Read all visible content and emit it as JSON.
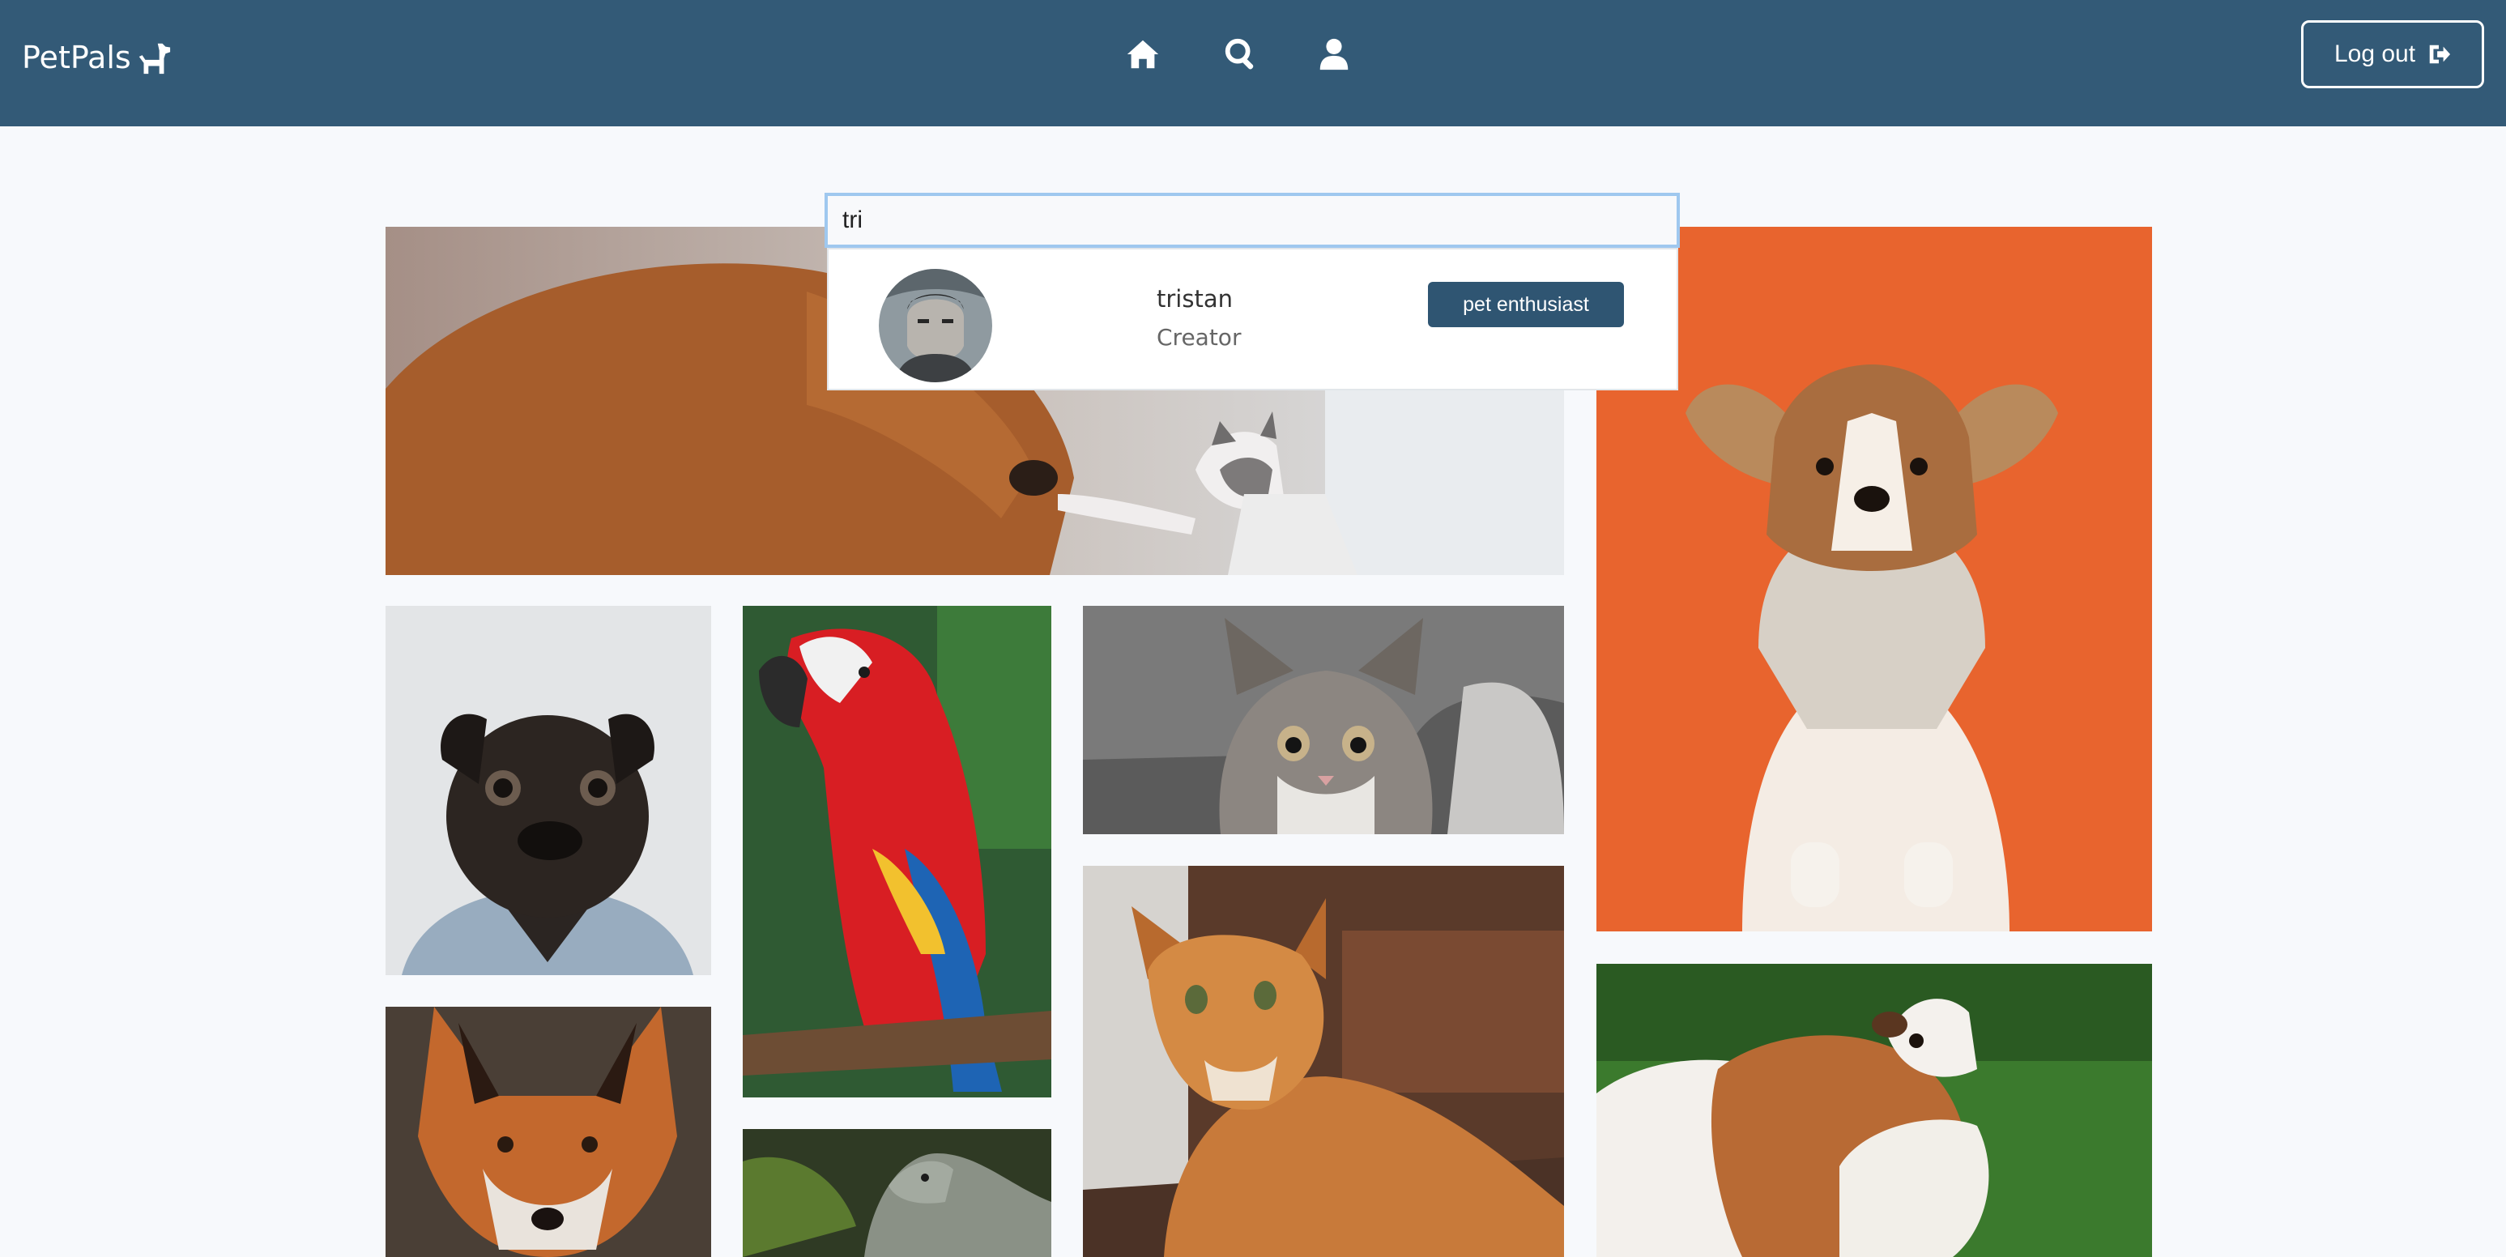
{
  "header": {
    "brand": "PetPals",
    "nav": [
      {
        "icon": "home-icon"
      },
      {
        "icon": "search-icon"
      },
      {
        "icon": "user-icon"
      }
    ],
    "logout_label": "Log out",
    "logout_icon": "sign-out-icon",
    "background": "#335a77"
  },
  "search": {
    "value": "tri",
    "results": [
      {
        "name": "tristan",
        "role": "Creator",
        "badge": "pet enthusiast"
      }
    ]
  },
  "gallery": [
    {
      "subject": "dog and kitten"
    },
    {
      "subject": "pug in denim jacket"
    },
    {
      "subject": "scarlet macaw"
    },
    {
      "subject": "tabby kitten"
    },
    {
      "subject": "corgi puppy"
    },
    {
      "subject": "fox"
    },
    {
      "subject": "iguana"
    },
    {
      "subject": "orange cat"
    },
    {
      "subject": "guinea pig"
    }
  ]
}
